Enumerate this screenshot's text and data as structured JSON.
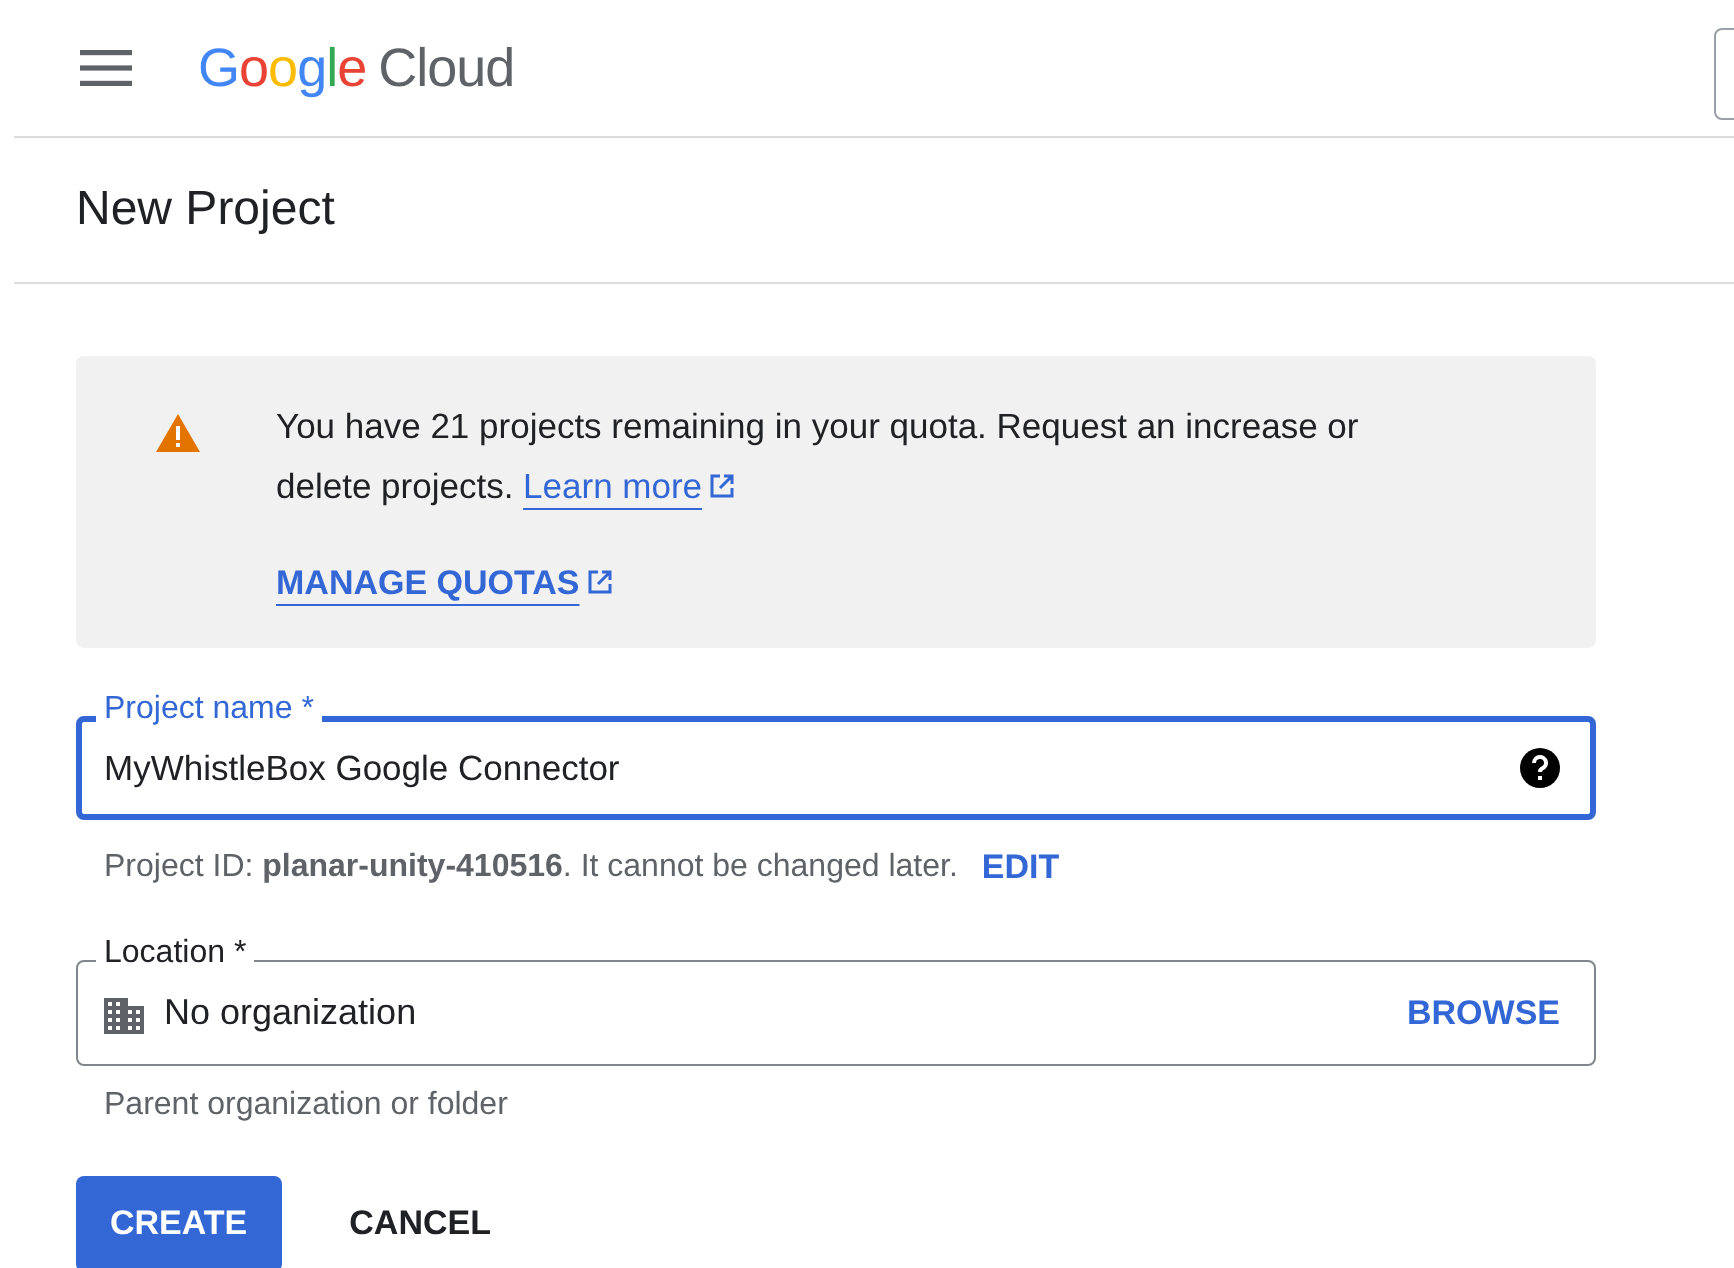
{
  "header": {
    "logo_brand": "Google",
    "logo_product": "Cloud"
  },
  "page_title": "New Project",
  "quota_banner": {
    "message": "You have 21 projects remaining in your quota. Request an increase or delete projects.",
    "link": "Learn more",
    "action": "MANAGE QUOTAS"
  },
  "project_name": {
    "label": "Project name *",
    "value": "MyWhistleBox Google Connector",
    "focused": true
  },
  "project_id": {
    "text": "Project ID: **planar-unity-410516**. It cannot be changed later.",
    "action": "EDIT"
  },
  "location": {
    "label": "Location *",
    "value": "No organization",
    "action": "BROWSE",
    "hint": "Parent organization or folder"
  },
  "buttons": [
    {
      "label": "CREATE",
      "kind": "primary"
    },
    {
      "label": "CANCEL",
      "kind": "text"
    }
  ]
}
